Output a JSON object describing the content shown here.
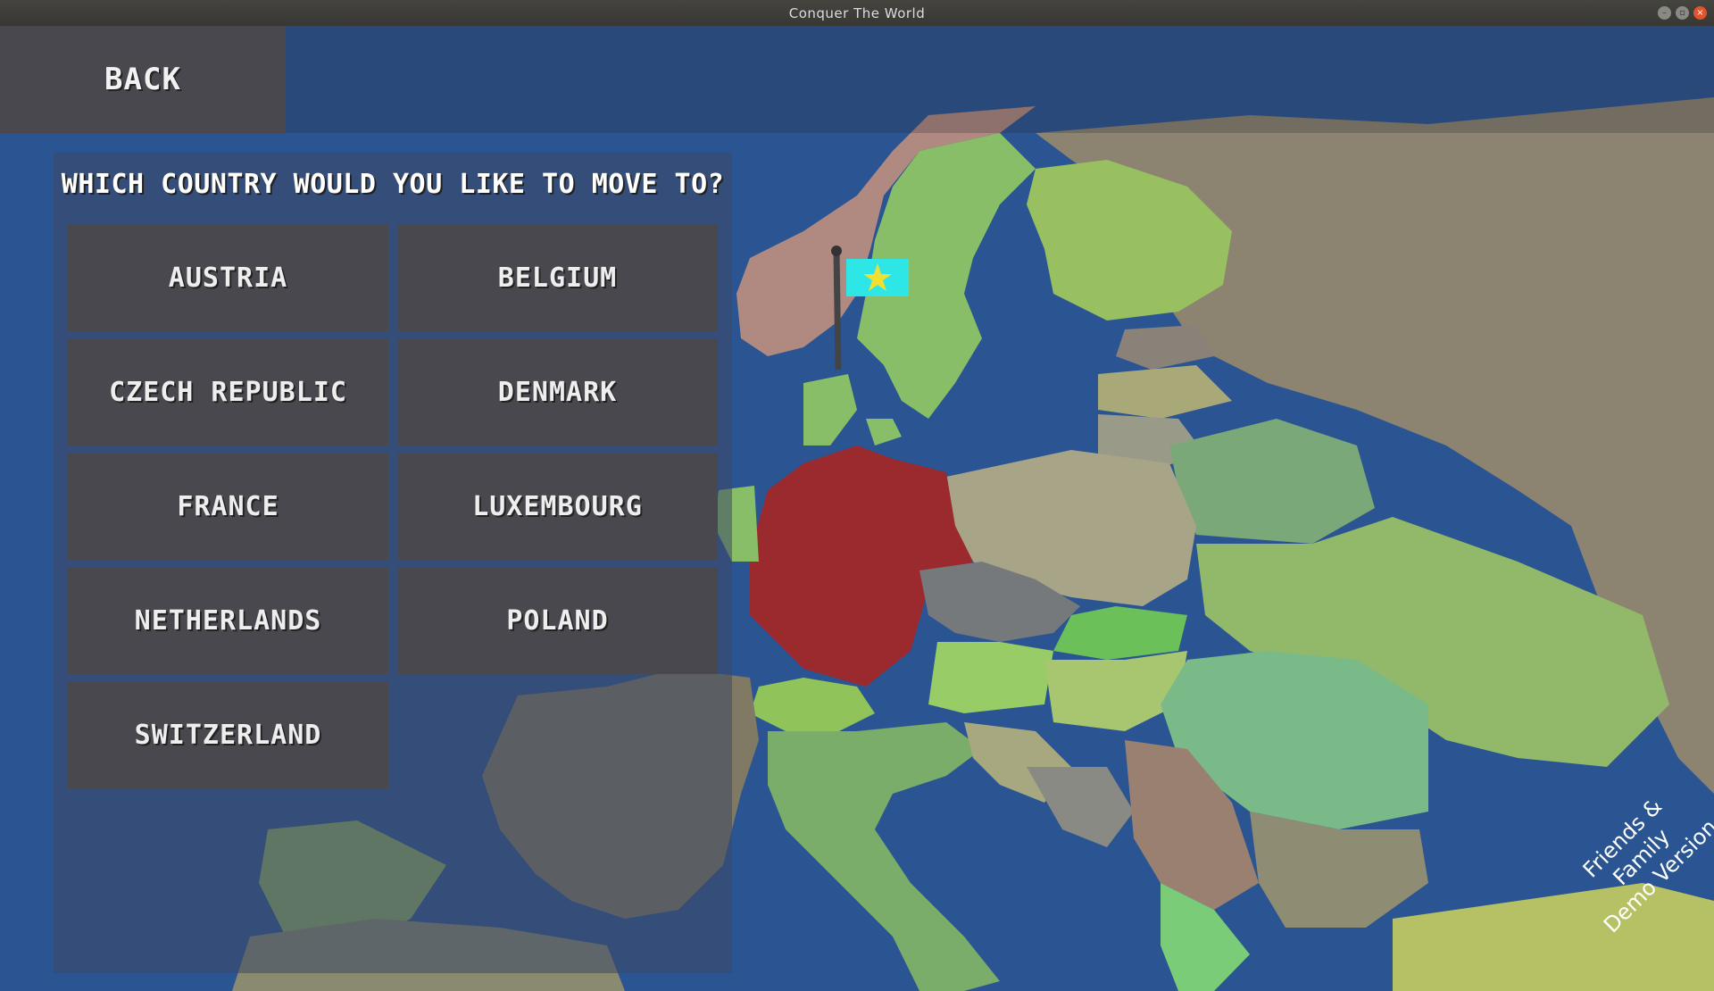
{
  "window": {
    "title": "Conquer The World",
    "controls": [
      "minimize-icon",
      "maximize-icon",
      "close-icon"
    ]
  },
  "back_button": {
    "label": "BACK"
  },
  "dialog": {
    "question": "WHICH COUNTRY WOULD YOU LIKE TO MOVE TO?",
    "countries": [
      "AUSTRIA",
      "BELGIUM",
      "CZECH REPUBLIC",
      "DENMARK",
      "FRANCE",
      "LUXEMBOURG",
      "NETHERLANDS",
      "POLAND",
      "SWITZERLAND"
    ]
  },
  "watermark": {
    "line1": "Friends & Family",
    "line2": "Demo Version"
  },
  "colors": {
    "sea": "#2a5592",
    "selected_country": "#9b2a2e",
    "button": "#4a484f",
    "flag": "#2fe6e6",
    "flag_star": "#f0e030"
  }
}
